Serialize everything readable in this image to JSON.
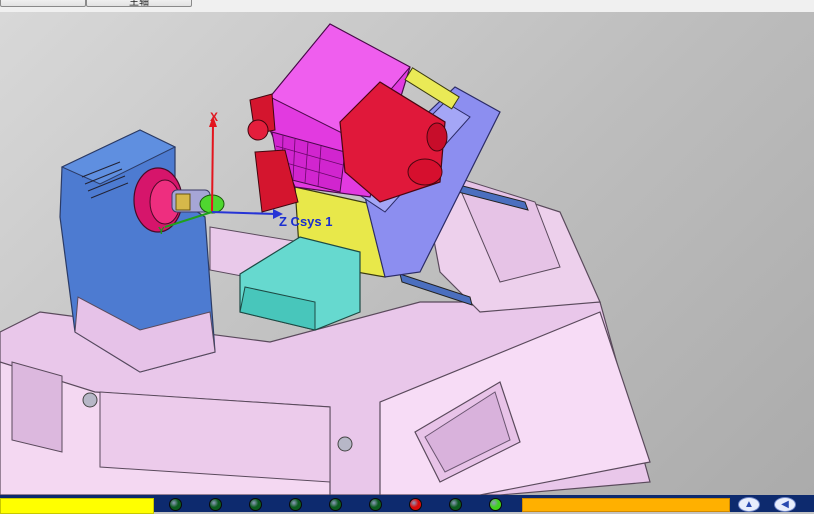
{
  "toolbar": {
    "buttons": [
      {
        "label": ""
      },
      {
        "label": "主轴"
      }
    ]
  },
  "scene": {
    "coordinate_system_label": "Z Csys 1",
    "axis_x_label": "X",
    "axis_y_label": "Y"
  },
  "status_bar": {
    "indicators": [
      {
        "name": "indicator-1",
        "state": "green"
      },
      {
        "name": "indicator-2",
        "state": "green"
      },
      {
        "name": "indicator-3",
        "state": "green"
      },
      {
        "name": "indicator-4",
        "state": "green"
      },
      {
        "name": "indicator-5",
        "state": "green"
      },
      {
        "name": "indicator-6",
        "state": "green"
      },
      {
        "name": "indicator-7",
        "state": "red"
      },
      {
        "name": "indicator-8",
        "state": "green"
      },
      {
        "name": "indicator-9",
        "state": "bright-green"
      }
    ],
    "nav_buttons": [
      {
        "icon": "arrow-up-icon"
      },
      {
        "icon": "arrow-left-icon"
      }
    ]
  },
  "colors": {
    "led_green": "#0b5a1e",
    "led_red": "#d90a0a",
    "led_bright_green": "#3fd11d",
    "status_yellow": "#ffff00",
    "status_orange": "#ffb000",
    "statusbar_blue": "#0d2a6e"
  }
}
